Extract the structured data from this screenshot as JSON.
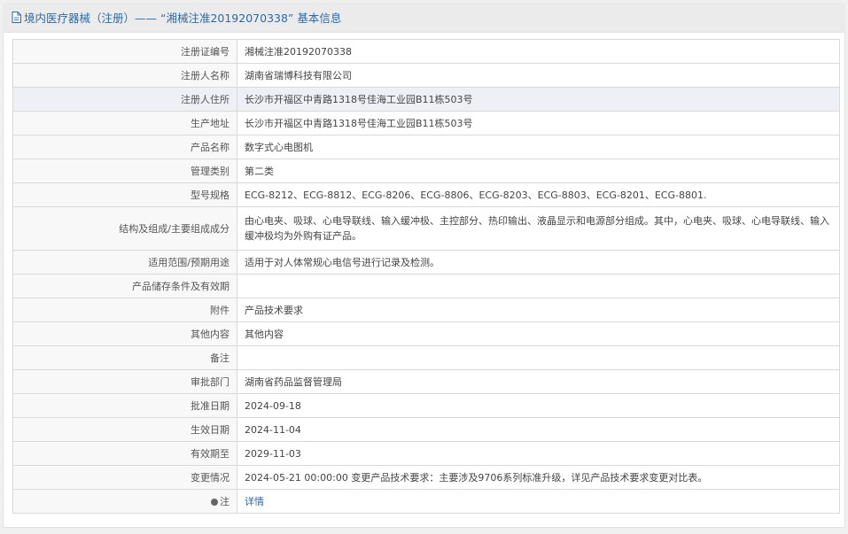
{
  "header": {
    "title": "境内医疗器械（注册）—— “湘械注准20192070338” 基本信息",
    "icon": "document-icon"
  },
  "rows": [
    {
      "label": "注册证编号",
      "value": "湘械注准20192070338"
    },
    {
      "label": "注册人名称",
      "value": "湖南省瑞博科技有限公司"
    },
    {
      "label": "注册人住所",
      "value": "长沙市开福区中青路1318号佳海工业园B11栋503号"
    },
    {
      "label": "生产地址",
      "value": "长沙市开福区中青路1318号佳海工业园B11栋503号"
    },
    {
      "label": "产品名称",
      "value": "数字式心电图机"
    },
    {
      "label": "管理类别",
      "value": "第二类"
    },
    {
      "label": "型号规格",
      "value": "ECG-8212、ECG-8812、ECG-8206、ECG-8806、ECG-8203、ECG-8803、ECG-8201、ECG-8801."
    },
    {
      "label": "结构及组成/主要组成成分",
      "value": "由心电夹、吸球、心电导联线、输入缓冲极、主控部分、热印输出、液晶显示和电源部分组成。其中，心电夹、吸球、心电导联线、输入缓冲极均为外购有证产品。"
    },
    {
      "label": "适用范围/预期用途",
      "value": "适用于对人体常规心电信号进行记录及检测。"
    },
    {
      "label": "产品储存条件及有效期",
      "value": ""
    },
    {
      "label": "附件",
      "value": "产品技术要求"
    },
    {
      "label": "其他内容",
      "value": "其他内容"
    },
    {
      "label": "备注",
      "value": ""
    },
    {
      "label": "审批部门",
      "value": "湖南省药品监督管理局"
    },
    {
      "label": "批准日期",
      "value": "2024-09-18"
    },
    {
      "label": "生效日期",
      "value": "2024-11-04"
    },
    {
      "label": "有效期至",
      "value": "2029-11-03"
    },
    {
      "label": "变更情况",
      "value": "2024-05-21 00:00:00 变更产品技术要求：主要涉及9706系列标准升级，详见产品技术要求变更对比表。"
    },
    {
      "label": "注",
      "value": "详情"
    }
  ]
}
